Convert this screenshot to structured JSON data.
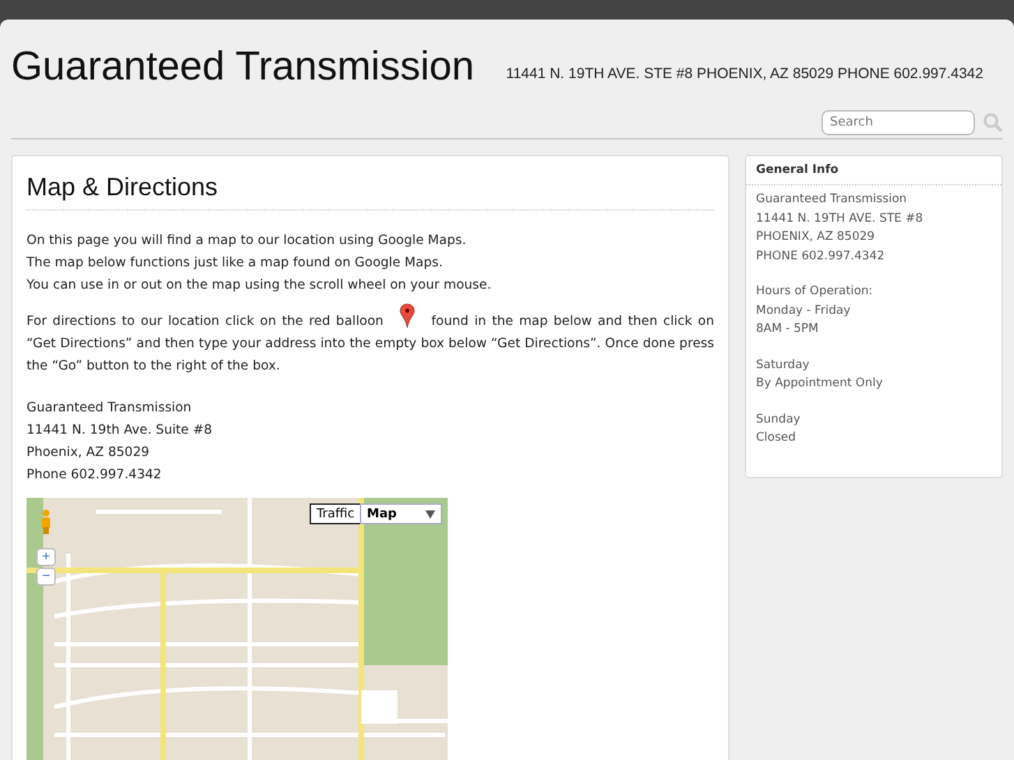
{
  "header": {
    "title": "Guaranteed Transmission",
    "address": "11441 N. 19TH AVE. STE #8 PHOENIX, AZ 85029 PHONE 602.997.4342"
  },
  "search": {
    "placeholder": "Search"
  },
  "main": {
    "heading": "Map & Directions",
    "intro": [
      "On this page you will find a map to our location using Google Maps.",
      "The map below functions just like a map found on Google Maps.",
      "You can use in or out on the map using the scroll wheel on your mouse."
    ],
    "directions_before": "For directions to our location click on the red balloon",
    "directions_after": "found in the map below and then click on “Get Directions” and then type your address into the empty box below “Get Directions”. Once done press the “Go” button to the right of the box.",
    "contact": [
      "Guaranteed Transmission",
      "11441 N. 19th Ave. Suite #8",
      "Phoenix, AZ 85029",
      "Phone 602.997.4342"
    ],
    "map": {
      "buttons": [
        {
          "label": "Traffic",
          "kind": "toggle"
        },
        {
          "label": "Map",
          "kind": "dropdown"
        }
      ],
      "zoom_in": "+",
      "zoom_out": "−"
    }
  },
  "sidebar": {
    "title": "General Info",
    "groups": [
      [
        "Guaranteed Transmission",
        "11441 N. 19TH AVE. STE #8",
        "PHOENIX, AZ 85029",
        "PHONE 602.997.4342"
      ],
      [
        "Hours of Operation:",
        "Monday - Friday",
        "8AM - 5PM"
      ],
      [
        "Saturday",
        "By Appointment Only"
      ],
      [
        "Sunday",
        "Closed"
      ]
    ]
  }
}
